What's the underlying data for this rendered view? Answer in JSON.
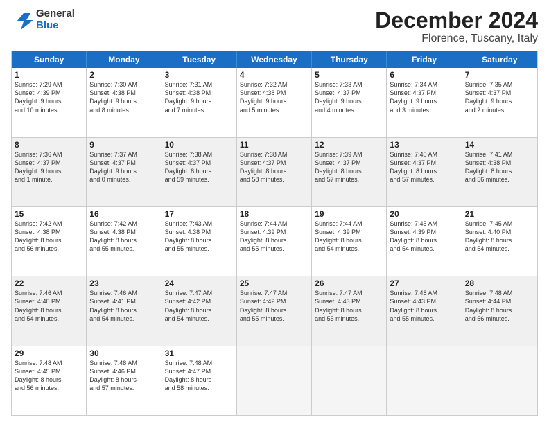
{
  "logo": {
    "general": "General",
    "blue": "Blue"
  },
  "title": {
    "month": "December 2024",
    "location": "Florence, Tuscany, Italy"
  },
  "calendar": {
    "headers": [
      "Sunday",
      "Monday",
      "Tuesday",
      "Wednesday",
      "Thursday",
      "Friday",
      "Saturday"
    ],
    "rows": [
      [
        {
          "day": "1",
          "lines": [
            "Sunrise: 7:29 AM",
            "Sunset: 4:39 PM",
            "Daylight: 9 hours",
            "and 10 minutes."
          ]
        },
        {
          "day": "2",
          "lines": [
            "Sunrise: 7:30 AM",
            "Sunset: 4:38 PM",
            "Daylight: 9 hours",
            "and 8 minutes."
          ]
        },
        {
          "day": "3",
          "lines": [
            "Sunrise: 7:31 AM",
            "Sunset: 4:38 PM",
            "Daylight: 9 hours",
            "and 7 minutes."
          ]
        },
        {
          "day": "4",
          "lines": [
            "Sunrise: 7:32 AM",
            "Sunset: 4:38 PM",
            "Daylight: 9 hours",
            "and 5 minutes."
          ]
        },
        {
          "day": "5",
          "lines": [
            "Sunrise: 7:33 AM",
            "Sunset: 4:37 PM",
            "Daylight: 9 hours",
            "and 4 minutes."
          ]
        },
        {
          "day": "6",
          "lines": [
            "Sunrise: 7:34 AM",
            "Sunset: 4:37 PM",
            "Daylight: 9 hours",
            "and 3 minutes."
          ]
        },
        {
          "day": "7",
          "lines": [
            "Sunrise: 7:35 AM",
            "Sunset: 4:37 PM",
            "Daylight: 9 hours",
            "and 2 minutes."
          ]
        }
      ],
      [
        {
          "day": "8",
          "lines": [
            "Sunrise: 7:36 AM",
            "Sunset: 4:37 PM",
            "Daylight: 9 hours",
            "and 1 minute."
          ],
          "shaded": true
        },
        {
          "day": "9",
          "lines": [
            "Sunrise: 7:37 AM",
            "Sunset: 4:37 PM",
            "Daylight: 9 hours",
            "and 0 minutes."
          ],
          "shaded": true
        },
        {
          "day": "10",
          "lines": [
            "Sunrise: 7:38 AM",
            "Sunset: 4:37 PM",
            "Daylight: 8 hours",
            "and 59 minutes."
          ],
          "shaded": true
        },
        {
          "day": "11",
          "lines": [
            "Sunrise: 7:38 AM",
            "Sunset: 4:37 PM",
            "Daylight: 8 hours",
            "and 58 minutes."
          ],
          "shaded": true
        },
        {
          "day": "12",
          "lines": [
            "Sunrise: 7:39 AM",
            "Sunset: 4:37 PM",
            "Daylight: 8 hours",
            "and 57 minutes."
          ],
          "shaded": true
        },
        {
          "day": "13",
          "lines": [
            "Sunrise: 7:40 AM",
            "Sunset: 4:37 PM",
            "Daylight: 8 hours",
            "and 57 minutes."
          ],
          "shaded": true
        },
        {
          "day": "14",
          "lines": [
            "Sunrise: 7:41 AM",
            "Sunset: 4:38 PM",
            "Daylight: 8 hours",
            "and 56 minutes."
          ],
          "shaded": true
        }
      ],
      [
        {
          "day": "15",
          "lines": [
            "Sunrise: 7:42 AM",
            "Sunset: 4:38 PM",
            "Daylight: 8 hours",
            "and 56 minutes."
          ]
        },
        {
          "day": "16",
          "lines": [
            "Sunrise: 7:42 AM",
            "Sunset: 4:38 PM",
            "Daylight: 8 hours",
            "and 55 minutes."
          ]
        },
        {
          "day": "17",
          "lines": [
            "Sunrise: 7:43 AM",
            "Sunset: 4:38 PM",
            "Daylight: 8 hours",
            "and 55 minutes."
          ]
        },
        {
          "day": "18",
          "lines": [
            "Sunrise: 7:44 AM",
            "Sunset: 4:39 PM",
            "Daylight: 8 hours",
            "and 55 minutes."
          ]
        },
        {
          "day": "19",
          "lines": [
            "Sunrise: 7:44 AM",
            "Sunset: 4:39 PM",
            "Daylight: 8 hours",
            "and 54 minutes."
          ]
        },
        {
          "day": "20",
          "lines": [
            "Sunrise: 7:45 AM",
            "Sunset: 4:39 PM",
            "Daylight: 8 hours",
            "and 54 minutes."
          ]
        },
        {
          "day": "21",
          "lines": [
            "Sunrise: 7:45 AM",
            "Sunset: 4:40 PM",
            "Daylight: 8 hours",
            "and 54 minutes."
          ]
        }
      ],
      [
        {
          "day": "22",
          "lines": [
            "Sunrise: 7:46 AM",
            "Sunset: 4:40 PM",
            "Daylight: 8 hours",
            "and 54 minutes."
          ],
          "shaded": true
        },
        {
          "day": "23",
          "lines": [
            "Sunrise: 7:46 AM",
            "Sunset: 4:41 PM",
            "Daylight: 8 hours",
            "and 54 minutes."
          ],
          "shaded": true
        },
        {
          "day": "24",
          "lines": [
            "Sunrise: 7:47 AM",
            "Sunset: 4:42 PM",
            "Daylight: 8 hours",
            "and 54 minutes."
          ],
          "shaded": true
        },
        {
          "day": "25",
          "lines": [
            "Sunrise: 7:47 AM",
            "Sunset: 4:42 PM",
            "Daylight: 8 hours",
            "and 55 minutes."
          ],
          "shaded": true
        },
        {
          "day": "26",
          "lines": [
            "Sunrise: 7:47 AM",
            "Sunset: 4:43 PM",
            "Daylight: 8 hours",
            "and 55 minutes."
          ],
          "shaded": true
        },
        {
          "day": "27",
          "lines": [
            "Sunrise: 7:48 AM",
            "Sunset: 4:43 PM",
            "Daylight: 8 hours",
            "and 55 minutes."
          ],
          "shaded": true
        },
        {
          "day": "28",
          "lines": [
            "Sunrise: 7:48 AM",
            "Sunset: 4:44 PM",
            "Daylight: 8 hours",
            "and 56 minutes."
          ],
          "shaded": true
        }
      ],
      [
        {
          "day": "29",
          "lines": [
            "Sunrise: 7:48 AM",
            "Sunset: 4:45 PM",
            "Daylight: 8 hours",
            "and 56 minutes."
          ]
        },
        {
          "day": "30",
          "lines": [
            "Sunrise: 7:48 AM",
            "Sunset: 4:46 PM",
            "Daylight: 8 hours",
            "and 57 minutes."
          ]
        },
        {
          "day": "31",
          "lines": [
            "Sunrise: 7:48 AM",
            "Sunset: 4:47 PM",
            "Daylight: 8 hours",
            "and 58 minutes."
          ]
        },
        {
          "day": "",
          "lines": [],
          "empty": true
        },
        {
          "day": "",
          "lines": [],
          "empty": true
        },
        {
          "day": "",
          "lines": [],
          "empty": true
        },
        {
          "day": "",
          "lines": [],
          "empty": true
        }
      ]
    ]
  }
}
